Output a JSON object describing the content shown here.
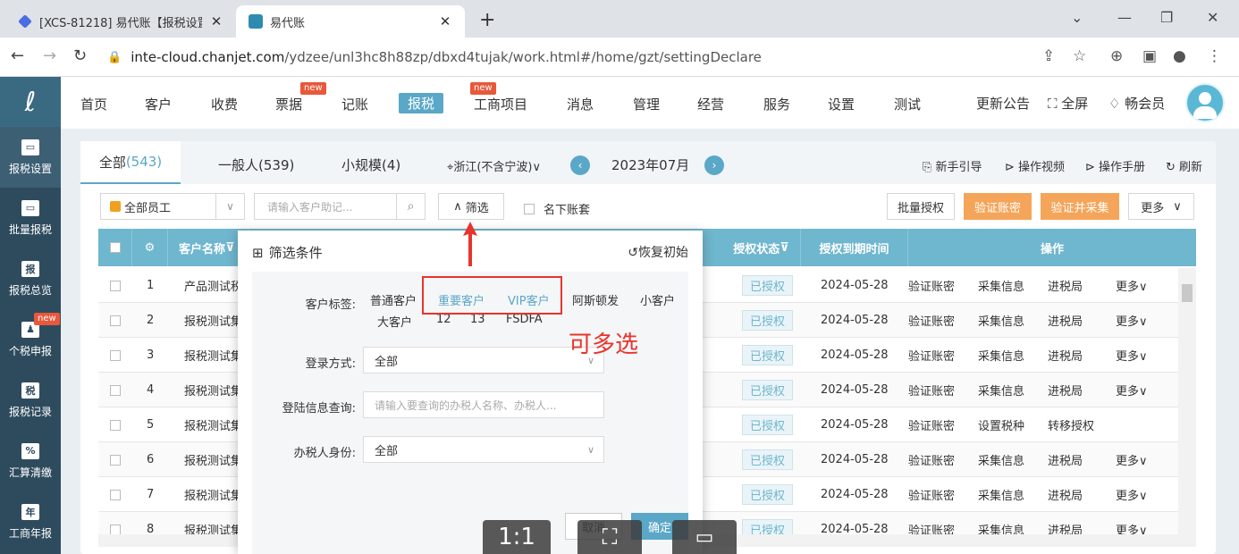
{
  "browser": {
    "tabs": [
      {
        "title": "[XCS-81218] 易代账【报税设置】",
        "favicon_color": "#4a6ee0"
      },
      {
        "title": "易代账",
        "favicon_color": "#2e8bb0"
      }
    ],
    "url_domain": "inte-cloud.chanjet.com",
    "url_path": "/ydzee/unl3hc8h88zp/dbxd4tujak/work.html#/home/gzt/settingDeclare"
  },
  "sidebar": {
    "items": [
      {
        "label": "报税设置",
        "icon": "monitor-icon"
      },
      {
        "label": "批量报税",
        "icon": "monitor-icon"
      },
      {
        "label": "报税总览",
        "icon": "report-icon"
      },
      {
        "label": "个税申报",
        "icon": "person-tax-icon",
        "badge": "new"
      },
      {
        "label": "报税记录",
        "icon": "tax-record-icon"
      },
      {
        "label": "汇算清缴",
        "icon": "calc-icon"
      },
      {
        "label": "工商年报",
        "icon": "annual-report-icon"
      }
    ]
  },
  "topnav": {
    "items": [
      "首页",
      "客户",
      "收费",
      "票据",
      "记账",
      "报税",
      "工商项目",
      "消息",
      "管理",
      "经营",
      "服务",
      "设置",
      "测试"
    ],
    "badge": "new",
    "right": [
      "更新公告",
      "全屏",
      "畅会员"
    ]
  },
  "content": {
    "tabs": [
      {
        "label": "全部",
        "count": "(543)"
      },
      {
        "label": "一般人(539)"
      },
      {
        "label": "小规模(4)"
      }
    ],
    "region": "浙江(不含宁波)",
    "period": "2023年07月",
    "links": [
      "新手引导",
      "操作视频",
      "操作手册",
      "刷新"
    ],
    "toolbar": {
      "staff_select": "全部员工",
      "search_placeholder": "请输入客户助记...",
      "filter_label": "筛选",
      "my_accounts_label": "名下账套",
      "batch_auth": "批量授权",
      "verify_pwd": "验证账密",
      "verify_collect": "验证并采集",
      "more": "更多"
    },
    "table": {
      "headers": [
        "客户名称",
        "授权状态",
        "授权到期时间",
        "操作"
      ],
      "rows": [
        {
          "no": "1",
          "name": "产品测试税",
          "status": "已授权",
          "expire": "2024-05-28",
          "ops": [
            "验证账密",
            "采集信息",
            "进税局",
            "更多"
          ]
        },
        {
          "no": "2",
          "name": "报税测试集",
          "status": "已授权",
          "expire": "2024-05-28",
          "ops": [
            "验证账密",
            "采集信息",
            "进税局",
            "更多"
          ]
        },
        {
          "no": "3",
          "name": "报税测试集",
          "status": "已授权",
          "expire": "2024-05-28",
          "ops": [
            "验证账密",
            "采集信息",
            "进税局",
            "更多"
          ]
        },
        {
          "no": "4",
          "name": "报税测试集",
          "status": "已授权",
          "expire": "2024-05-28",
          "ops": [
            "验证账密",
            "采集信息",
            "进税局",
            "更多"
          ]
        },
        {
          "no": "5",
          "name": "报税测试集",
          "status": "已授权",
          "expire": "2024-05-28",
          "ops": [
            "验证账密",
            "设置税种",
            "转移授权",
            ""
          ]
        },
        {
          "no": "6",
          "name": "报税测试集",
          "status": "已授权",
          "expire": "2024-05-28",
          "ops": [
            "验证账密",
            "采集信息",
            "进税局",
            "更多"
          ]
        },
        {
          "no": "7",
          "name": "报税测试集",
          "status": "已授权",
          "expire": "2024-05-28",
          "ops": [
            "验证账密",
            "采集信息",
            "进税局",
            "更多"
          ]
        },
        {
          "no": "8",
          "name": "报税测试集",
          "status": "已授权",
          "expire": "2024-05-28",
          "ops": [
            "验证账密",
            "采集信息",
            "进税局",
            "更多"
          ]
        }
      ]
    }
  },
  "filter_popup": {
    "title": "筛选条件",
    "reset": "恢复初始",
    "tag_label": "客户标签:",
    "tags_row1": [
      "普通客户",
      "重要客户",
      "VIP客户",
      "阿斯顿发",
      "小客户"
    ],
    "tags_row2": [
      "大客户",
      "12",
      "13",
      "FSDFA"
    ],
    "login_label": "登录方式:",
    "login_value": "全部",
    "query_label": "登陆信息查询:",
    "query_placeholder": "请输入要查询的办税人名称、办税人...",
    "role_label": "办税人身份:",
    "role_value": "全部",
    "cancel": "取消",
    "confirm": "确定"
  },
  "annotation": {
    "text": "可多选",
    "color": "#e8342c"
  },
  "video_controls": [
    "1:1"
  ]
}
